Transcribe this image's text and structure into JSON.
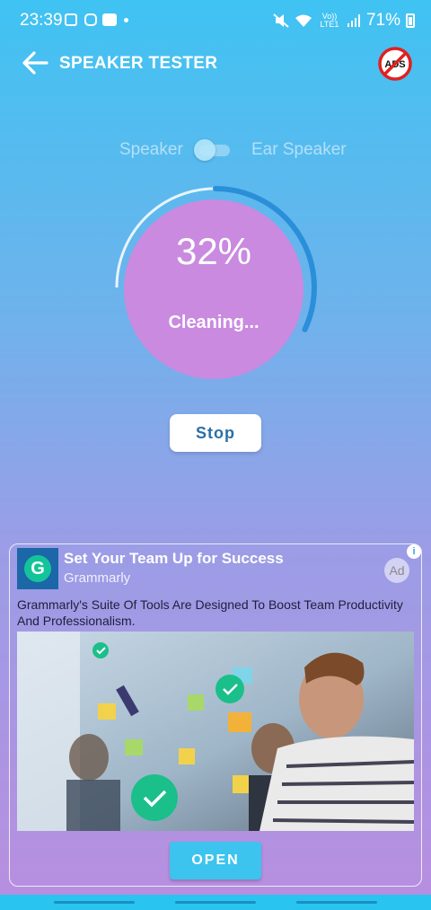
{
  "status_bar": {
    "time": "23:39",
    "network": "Vo)) LTE1",
    "battery": "71%",
    "icons": [
      "gallery-icon",
      "instagram-icon",
      "youtube-icon",
      "dot-icon",
      "mute-icon",
      "wifi-icon",
      "signal-icon",
      "battery-icon"
    ]
  },
  "app_bar": {
    "title": "SPEAKER TESTER",
    "ads_icon_label": "ADS"
  },
  "toggle": {
    "left_label": "Speaker",
    "right_label": "Ear Speaker"
  },
  "progress": {
    "percent_text": "32%",
    "value": 0.32,
    "status": "Cleaning..."
  },
  "stop_button": "Stop",
  "ad": {
    "title": "Set Your Team Up for Success",
    "brand": "Grammarly",
    "badge": "Ad",
    "info": "i",
    "logo_letter": "G",
    "description": "Grammarly's Suite Of Tools Are Designed To Boost Team Productivity And Professionalism.",
    "cta": "OPEN"
  },
  "colors": {
    "accent": "#3cc4ee",
    "gauge_fill": "#c98ae0",
    "gauge_ring": "#2a8fd8",
    "stop_text": "#2a6fa8"
  }
}
